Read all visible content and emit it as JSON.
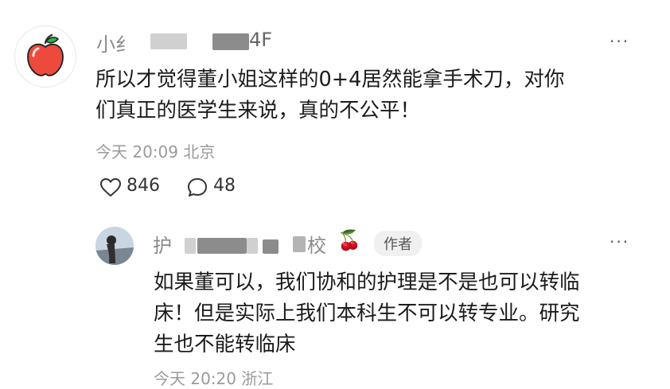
{
  "comment": {
    "username_visible_start": "小纟",
    "floor": "4F",
    "text_line1": "所以才觉得董小姐这样的0+4居然能拿手术刀，对你",
    "text_line2": "们真正的医学生来说，真的不公平！",
    "time": "今天 20:09 北京",
    "likes": "846",
    "replies": "48",
    "avatar_icon": "apple-icon",
    "more": "···"
  },
  "reply": {
    "username_visible_start": "护",
    "username_visible_end": "校",
    "username_emoji": "🍒",
    "badge": "作者",
    "text_line1": "如果董可以，我们协和的护理是不是也可以转临",
    "text_line2": "床！但是实际上我们本科生不可以转专业。研究",
    "text_line3": "生也不能转临床",
    "time": "今天 20:20 浙江",
    "more": "···"
  },
  "colors": {
    "secondary_text": "#8a8a8a",
    "primary_text": "#1b1b1b",
    "badge_bg": "#f0f0f0"
  }
}
